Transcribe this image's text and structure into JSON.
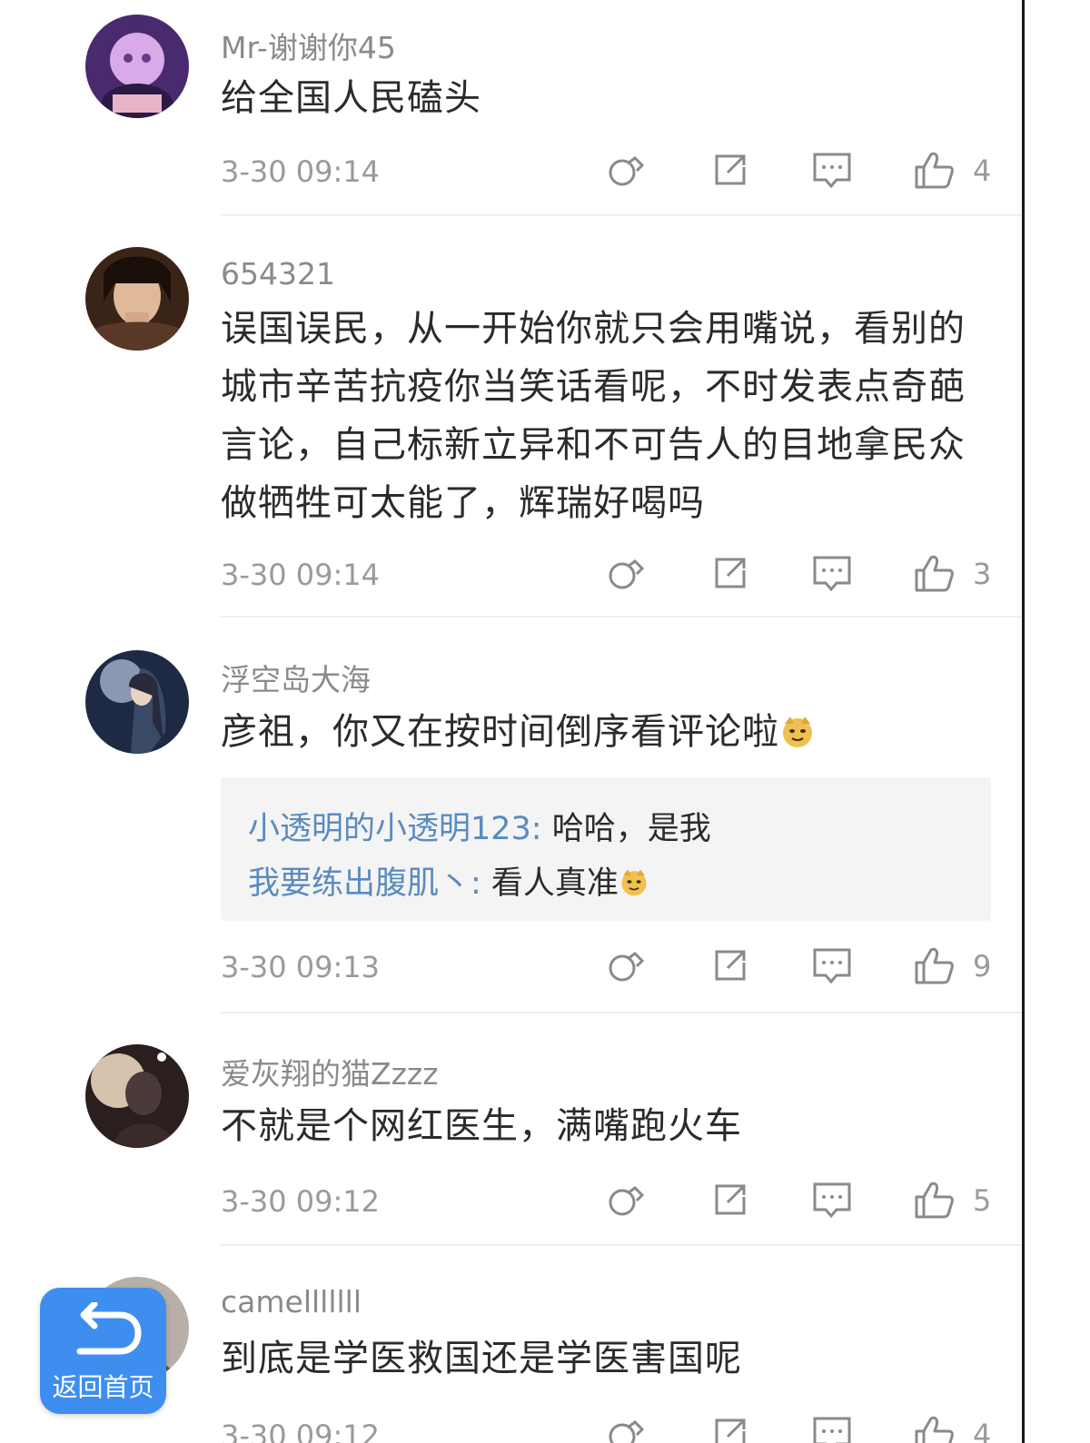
{
  "comments": [
    {
      "username": "Mr-谢谢你45",
      "content": "给全国人民磕头",
      "timestamp": "3-30 09:14",
      "likes": "4"
    },
    {
      "username": "654321",
      "content": "误国误民，从一开始你就只会用嘴说，看别的城市辛苦抗疫你当笑话看呢，不时发表点奇葩言论，自己标新立异和不可告人的目地拿民众做牺牲可太能了，辉瑞好喝吗",
      "timestamp": "3-30 09:14",
      "likes": "3"
    },
    {
      "username": "浮空岛大海",
      "content": "彦祖，你又在按时间倒序看评论啦",
      "content_emoji": "doge-emoji",
      "replies": [
        {
          "user": "小透明的小透明123:",
          "text": " 哈哈，是我"
        },
        {
          "user": "我要练出腹肌丶:",
          "text": " 看人真准",
          "emoji": "doge-emoji"
        }
      ],
      "timestamp": "3-30 09:13",
      "likes": "9"
    },
    {
      "username": "爱灰翔的猫Zzzz",
      "content": "不就是个网红医生，满嘴跑火车",
      "timestamp": "3-30 09:12",
      "likes": "5"
    },
    {
      "username": "camelllllll",
      "content": "到底是学医救国还是学医害国呢",
      "timestamp": "3-30 09:12",
      "likes": "4"
    }
  ],
  "icons": {
    "forward": "forward-icon",
    "share": "share-icon",
    "reply": "comment-icon",
    "like": "thumbs-up-icon"
  },
  "home_button": {
    "label": "返回首页",
    "icon": "return-arrow-icon"
  },
  "colors": {
    "reply_username": "#5a8bbf",
    "home_button_bg": "#3e8ef0",
    "meta_gray": "#9a9a9a"
  }
}
